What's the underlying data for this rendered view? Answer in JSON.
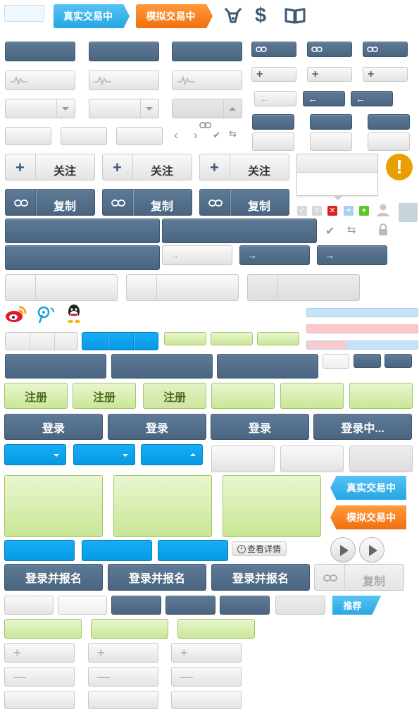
{
  "tags": {
    "real_trading": "真实交易中",
    "sim_trading": "模拟交易中",
    "recommend": "推荐"
  },
  "icons": {
    "bull": "bull-icon",
    "dollar": "dollar-icon",
    "book": "book-icon",
    "link": "link-icon",
    "plus": "plus-icon",
    "minus": "minus-icon",
    "arrow_left": "arrow-left-icon",
    "arrow_right": "arrow-right-icon",
    "chevron_left": "chevron-left-icon",
    "chevron_right": "chevron-right-icon",
    "check": "check-icon",
    "swap": "swap-icon",
    "lock": "lock-icon",
    "user": "user-icon",
    "warning": "warning-icon",
    "weibo": "weibo-icon",
    "tencent_weibo": "tencent-weibo-icon",
    "qq": "qq-icon",
    "zoom": "zoom-icon",
    "play": "play-icon"
  },
  "buttons": {
    "follow": "关注",
    "copy": "复制",
    "register": "注册",
    "login": "登录",
    "logging_in": "登录中...",
    "login_and_signup": "登录并报名",
    "view_details": "查看详情"
  },
  "colors": {
    "slate": "#4f6b86",
    "green": "#c9e796",
    "sky": "#0599e6",
    "orange": "#f37a12",
    "tag_blue": "#3cb5ec",
    "warning": "#e8a000",
    "error": "#e02020",
    "success": "#5cc52a"
  },
  "progress": {
    "blue_fill": 1.0,
    "pink_fill": 1.0,
    "mixed_pink_fill": 0.36
  }
}
